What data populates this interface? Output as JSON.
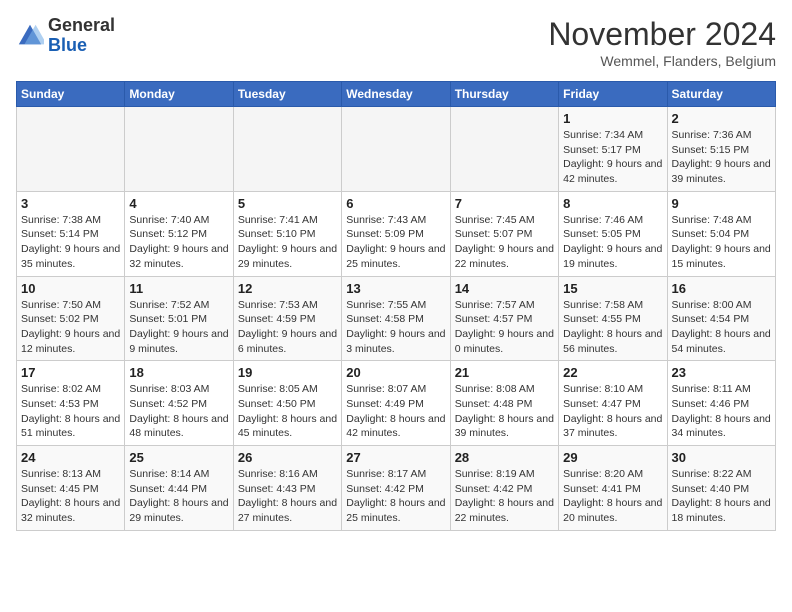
{
  "header": {
    "logo_general": "General",
    "logo_blue": "Blue",
    "month_title": "November 2024",
    "subtitle": "Wemmel, Flanders, Belgium"
  },
  "weekdays": [
    "Sunday",
    "Monday",
    "Tuesday",
    "Wednesday",
    "Thursday",
    "Friday",
    "Saturday"
  ],
  "weeks": [
    [
      {
        "day": "",
        "info": ""
      },
      {
        "day": "",
        "info": ""
      },
      {
        "day": "",
        "info": ""
      },
      {
        "day": "",
        "info": ""
      },
      {
        "day": "",
        "info": ""
      },
      {
        "day": "1",
        "info": "Sunrise: 7:34 AM\nSunset: 5:17 PM\nDaylight: 9 hours and 42 minutes."
      },
      {
        "day": "2",
        "info": "Sunrise: 7:36 AM\nSunset: 5:15 PM\nDaylight: 9 hours and 39 minutes."
      }
    ],
    [
      {
        "day": "3",
        "info": "Sunrise: 7:38 AM\nSunset: 5:14 PM\nDaylight: 9 hours and 35 minutes."
      },
      {
        "day": "4",
        "info": "Sunrise: 7:40 AM\nSunset: 5:12 PM\nDaylight: 9 hours and 32 minutes."
      },
      {
        "day": "5",
        "info": "Sunrise: 7:41 AM\nSunset: 5:10 PM\nDaylight: 9 hours and 29 minutes."
      },
      {
        "day": "6",
        "info": "Sunrise: 7:43 AM\nSunset: 5:09 PM\nDaylight: 9 hours and 25 minutes."
      },
      {
        "day": "7",
        "info": "Sunrise: 7:45 AM\nSunset: 5:07 PM\nDaylight: 9 hours and 22 minutes."
      },
      {
        "day": "8",
        "info": "Sunrise: 7:46 AM\nSunset: 5:05 PM\nDaylight: 9 hours and 19 minutes."
      },
      {
        "day": "9",
        "info": "Sunrise: 7:48 AM\nSunset: 5:04 PM\nDaylight: 9 hours and 15 minutes."
      }
    ],
    [
      {
        "day": "10",
        "info": "Sunrise: 7:50 AM\nSunset: 5:02 PM\nDaylight: 9 hours and 12 minutes."
      },
      {
        "day": "11",
        "info": "Sunrise: 7:52 AM\nSunset: 5:01 PM\nDaylight: 9 hours and 9 minutes."
      },
      {
        "day": "12",
        "info": "Sunrise: 7:53 AM\nSunset: 4:59 PM\nDaylight: 9 hours and 6 minutes."
      },
      {
        "day": "13",
        "info": "Sunrise: 7:55 AM\nSunset: 4:58 PM\nDaylight: 9 hours and 3 minutes."
      },
      {
        "day": "14",
        "info": "Sunrise: 7:57 AM\nSunset: 4:57 PM\nDaylight: 9 hours and 0 minutes."
      },
      {
        "day": "15",
        "info": "Sunrise: 7:58 AM\nSunset: 4:55 PM\nDaylight: 8 hours and 56 minutes."
      },
      {
        "day": "16",
        "info": "Sunrise: 8:00 AM\nSunset: 4:54 PM\nDaylight: 8 hours and 54 minutes."
      }
    ],
    [
      {
        "day": "17",
        "info": "Sunrise: 8:02 AM\nSunset: 4:53 PM\nDaylight: 8 hours and 51 minutes."
      },
      {
        "day": "18",
        "info": "Sunrise: 8:03 AM\nSunset: 4:52 PM\nDaylight: 8 hours and 48 minutes."
      },
      {
        "day": "19",
        "info": "Sunrise: 8:05 AM\nSunset: 4:50 PM\nDaylight: 8 hours and 45 minutes."
      },
      {
        "day": "20",
        "info": "Sunrise: 8:07 AM\nSunset: 4:49 PM\nDaylight: 8 hours and 42 minutes."
      },
      {
        "day": "21",
        "info": "Sunrise: 8:08 AM\nSunset: 4:48 PM\nDaylight: 8 hours and 39 minutes."
      },
      {
        "day": "22",
        "info": "Sunrise: 8:10 AM\nSunset: 4:47 PM\nDaylight: 8 hours and 37 minutes."
      },
      {
        "day": "23",
        "info": "Sunrise: 8:11 AM\nSunset: 4:46 PM\nDaylight: 8 hours and 34 minutes."
      }
    ],
    [
      {
        "day": "24",
        "info": "Sunrise: 8:13 AM\nSunset: 4:45 PM\nDaylight: 8 hours and 32 minutes."
      },
      {
        "day": "25",
        "info": "Sunrise: 8:14 AM\nSunset: 4:44 PM\nDaylight: 8 hours and 29 minutes."
      },
      {
        "day": "26",
        "info": "Sunrise: 8:16 AM\nSunset: 4:43 PM\nDaylight: 8 hours and 27 minutes."
      },
      {
        "day": "27",
        "info": "Sunrise: 8:17 AM\nSunset: 4:42 PM\nDaylight: 8 hours and 25 minutes."
      },
      {
        "day": "28",
        "info": "Sunrise: 8:19 AM\nSunset: 4:42 PM\nDaylight: 8 hours and 22 minutes."
      },
      {
        "day": "29",
        "info": "Sunrise: 8:20 AM\nSunset: 4:41 PM\nDaylight: 8 hours and 20 minutes."
      },
      {
        "day": "30",
        "info": "Sunrise: 8:22 AM\nSunset: 4:40 PM\nDaylight: 8 hours and 18 minutes."
      }
    ]
  ]
}
